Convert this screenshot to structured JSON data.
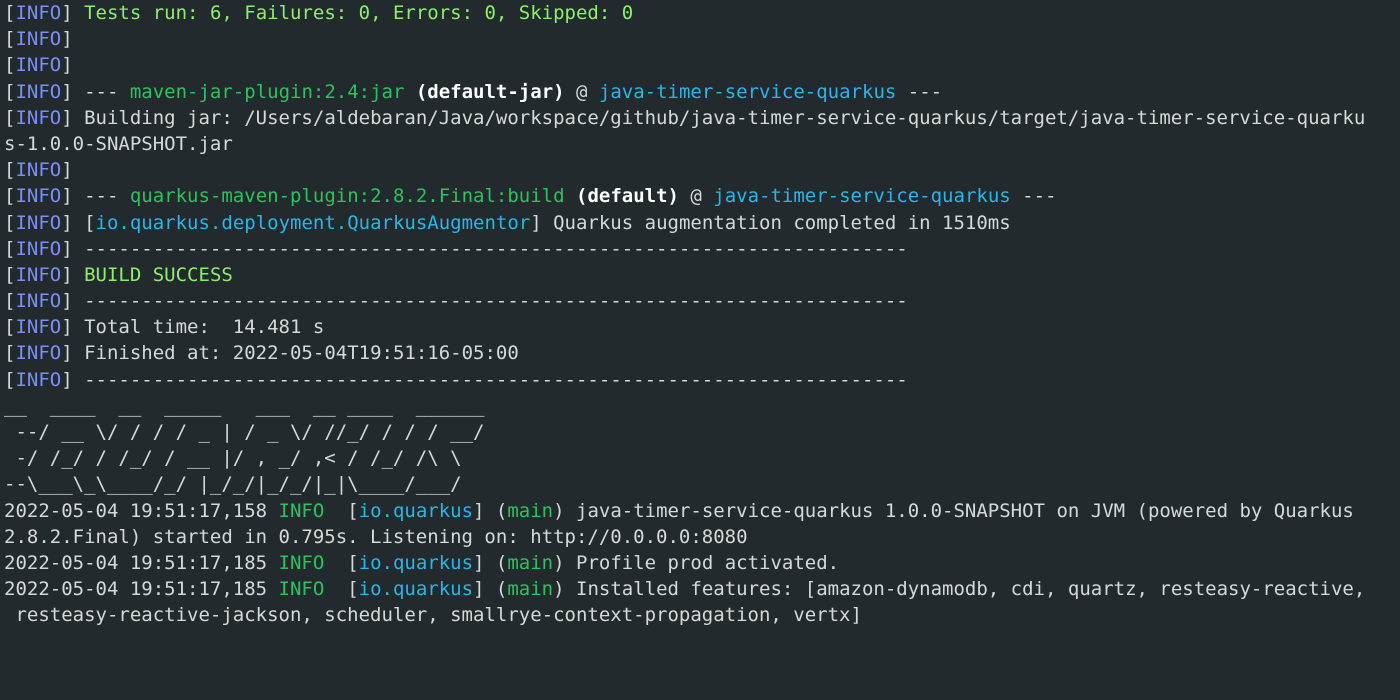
{
  "terminal": {
    "lines": [
      {
        "segments": [
          {
            "text": "[",
            "cls": ""
          },
          {
            "text": "INFO",
            "cls": "c-info"
          },
          {
            "text": "] ",
            "cls": ""
          },
          {
            "text": "Tests run: 6, Failures: 0, Errors: 0, Skipped: 0",
            "cls": "c-green"
          }
        ]
      },
      {
        "segments": [
          {
            "text": "[",
            "cls": ""
          },
          {
            "text": "INFO",
            "cls": "c-info"
          },
          {
            "text": "]",
            "cls": ""
          }
        ]
      },
      {
        "segments": [
          {
            "text": "[",
            "cls": ""
          },
          {
            "text": "INFO",
            "cls": "c-info"
          },
          {
            "text": "]",
            "cls": ""
          }
        ]
      },
      {
        "segments": [
          {
            "text": "[",
            "cls": ""
          },
          {
            "text": "INFO",
            "cls": "c-info"
          },
          {
            "text": "] --- ",
            "cls": ""
          },
          {
            "text": "maven-jar-plugin:2.4:jar",
            "cls": "c-plugin"
          },
          {
            "text": " ",
            "cls": ""
          },
          {
            "text": "(default-jar)",
            "cls": "c-bold"
          },
          {
            "text": " @ ",
            "cls": ""
          },
          {
            "text": "java-timer-service-quarkus",
            "cls": "c-cyan"
          },
          {
            "text": " ---",
            "cls": ""
          }
        ]
      },
      {
        "segments": [
          {
            "text": "[",
            "cls": ""
          },
          {
            "text": "INFO",
            "cls": "c-info"
          },
          {
            "text": "] Building jar: /Users/aldebaran/Java/workspace/github/java-timer-service-quarkus/target/java-timer-service-quarku",
            "cls": ""
          }
        ]
      },
      {
        "segments": [
          {
            "text": "s-1.0.0-SNAPSHOT.jar",
            "cls": ""
          }
        ]
      },
      {
        "segments": [
          {
            "text": "[",
            "cls": ""
          },
          {
            "text": "INFO",
            "cls": "c-info"
          },
          {
            "text": "]",
            "cls": ""
          }
        ]
      },
      {
        "segments": [
          {
            "text": "[",
            "cls": ""
          },
          {
            "text": "INFO",
            "cls": "c-info"
          },
          {
            "text": "] --- ",
            "cls": ""
          },
          {
            "text": "quarkus-maven-plugin:2.8.2.Final:build",
            "cls": "c-plugin"
          },
          {
            "text": " ",
            "cls": ""
          },
          {
            "text": "(default)",
            "cls": "c-bold"
          },
          {
            "text": " @ ",
            "cls": ""
          },
          {
            "text": "java-timer-service-quarkus",
            "cls": "c-cyan"
          },
          {
            "text": " ---",
            "cls": ""
          }
        ]
      },
      {
        "segments": [
          {
            "text": "[",
            "cls": ""
          },
          {
            "text": "INFO",
            "cls": "c-info"
          },
          {
            "text": "] [",
            "cls": ""
          },
          {
            "text": "io.quarkus.deployment.QuarkusAugmentor",
            "cls": "c-cyan"
          },
          {
            "text": "] Quarkus augmentation completed in 1510ms",
            "cls": ""
          }
        ]
      },
      {
        "segments": [
          {
            "text": "[",
            "cls": ""
          },
          {
            "text": "INFO",
            "cls": "c-info"
          },
          {
            "text": "] ------------------------------------------------------------------------",
            "cls": ""
          }
        ]
      },
      {
        "segments": [
          {
            "text": "[",
            "cls": ""
          },
          {
            "text": "INFO",
            "cls": "c-info"
          },
          {
            "text": "] ",
            "cls": ""
          },
          {
            "text": "BUILD SUCCESS",
            "cls": "c-green"
          }
        ]
      },
      {
        "segments": [
          {
            "text": "[",
            "cls": ""
          },
          {
            "text": "INFO",
            "cls": "c-info"
          },
          {
            "text": "] ------------------------------------------------------------------------",
            "cls": ""
          }
        ]
      },
      {
        "segments": [
          {
            "text": "[",
            "cls": ""
          },
          {
            "text": "INFO",
            "cls": "c-info"
          },
          {
            "text": "] Total time:  14.481 s",
            "cls": ""
          }
        ]
      },
      {
        "segments": [
          {
            "text": "[",
            "cls": ""
          },
          {
            "text": "INFO",
            "cls": "c-info"
          },
          {
            "text": "] Finished at: 2022-05-04T19:51:16-05:00",
            "cls": ""
          }
        ]
      },
      {
        "segments": [
          {
            "text": "[",
            "cls": ""
          },
          {
            "text": "INFO",
            "cls": "c-info"
          },
          {
            "text": "] ------------------------------------------------------------------------",
            "cls": ""
          }
        ]
      },
      {
        "segments": [
          {
            "text": "__  ____  __  _____   ___  __ ____  ______",
            "cls": ""
          }
        ]
      },
      {
        "segments": [
          {
            "text": " --/ __ \\/ / / / _ | / _ \\/ //_/ / / / __/",
            "cls": ""
          }
        ]
      },
      {
        "segments": [
          {
            "text": " -/ /_/ / /_/ / __ |/ , _/ ,< / /_/ /\\ \\",
            "cls": ""
          }
        ]
      },
      {
        "segments": [
          {
            "text": "--\\___\\_\\____/_/ |_/_/|_/_/|_|\\____/___/",
            "cls": ""
          }
        ]
      },
      {
        "segments": [
          {
            "text": "2022-05-04 19:51:17,158 ",
            "cls": ""
          },
          {
            "text": "INFO",
            "cls": "c-info-green"
          },
          {
            "text": "  [",
            "cls": ""
          },
          {
            "text": "io.quarkus",
            "cls": "c-cyan"
          },
          {
            "text": "] (",
            "cls": ""
          },
          {
            "text": "main",
            "cls": "c-main"
          },
          {
            "text": ") java-timer-service-quarkus 1.0.0-SNAPSHOT on JVM (powered by Quarkus",
            "cls": ""
          }
        ]
      },
      {
        "segments": [
          {
            "text": "2.8.2.Final) started in 0.795s. Listening on: http://0.0.0.0:8080",
            "cls": ""
          }
        ]
      },
      {
        "segments": [
          {
            "text": "2022-05-04 19:51:17,185 ",
            "cls": ""
          },
          {
            "text": "INFO",
            "cls": "c-info-green"
          },
          {
            "text": "  [",
            "cls": ""
          },
          {
            "text": "io.quarkus",
            "cls": "c-cyan"
          },
          {
            "text": "] (",
            "cls": ""
          },
          {
            "text": "main",
            "cls": "c-main"
          },
          {
            "text": ") Profile prod activated.",
            "cls": ""
          }
        ]
      },
      {
        "segments": [
          {
            "text": "2022-05-04 19:51:17,185 ",
            "cls": ""
          },
          {
            "text": "INFO",
            "cls": "c-info-green"
          },
          {
            "text": "  [",
            "cls": ""
          },
          {
            "text": "io.quarkus",
            "cls": "c-cyan"
          },
          {
            "text": "] (",
            "cls": ""
          },
          {
            "text": "main",
            "cls": "c-main"
          },
          {
            "text": ") Installed features: [amazon-dynamodb, cdi, quartz, resteasy-reactive,",
            "cls": ""
          }
        ]
      },
      {
        "segments": [
          {
            "text": " resteasy-reactive-jackson, scheduler, smallrye-context-propagation, vertx]",
            "cls": ""
          }
        ]
      }
    ]
  }
}
